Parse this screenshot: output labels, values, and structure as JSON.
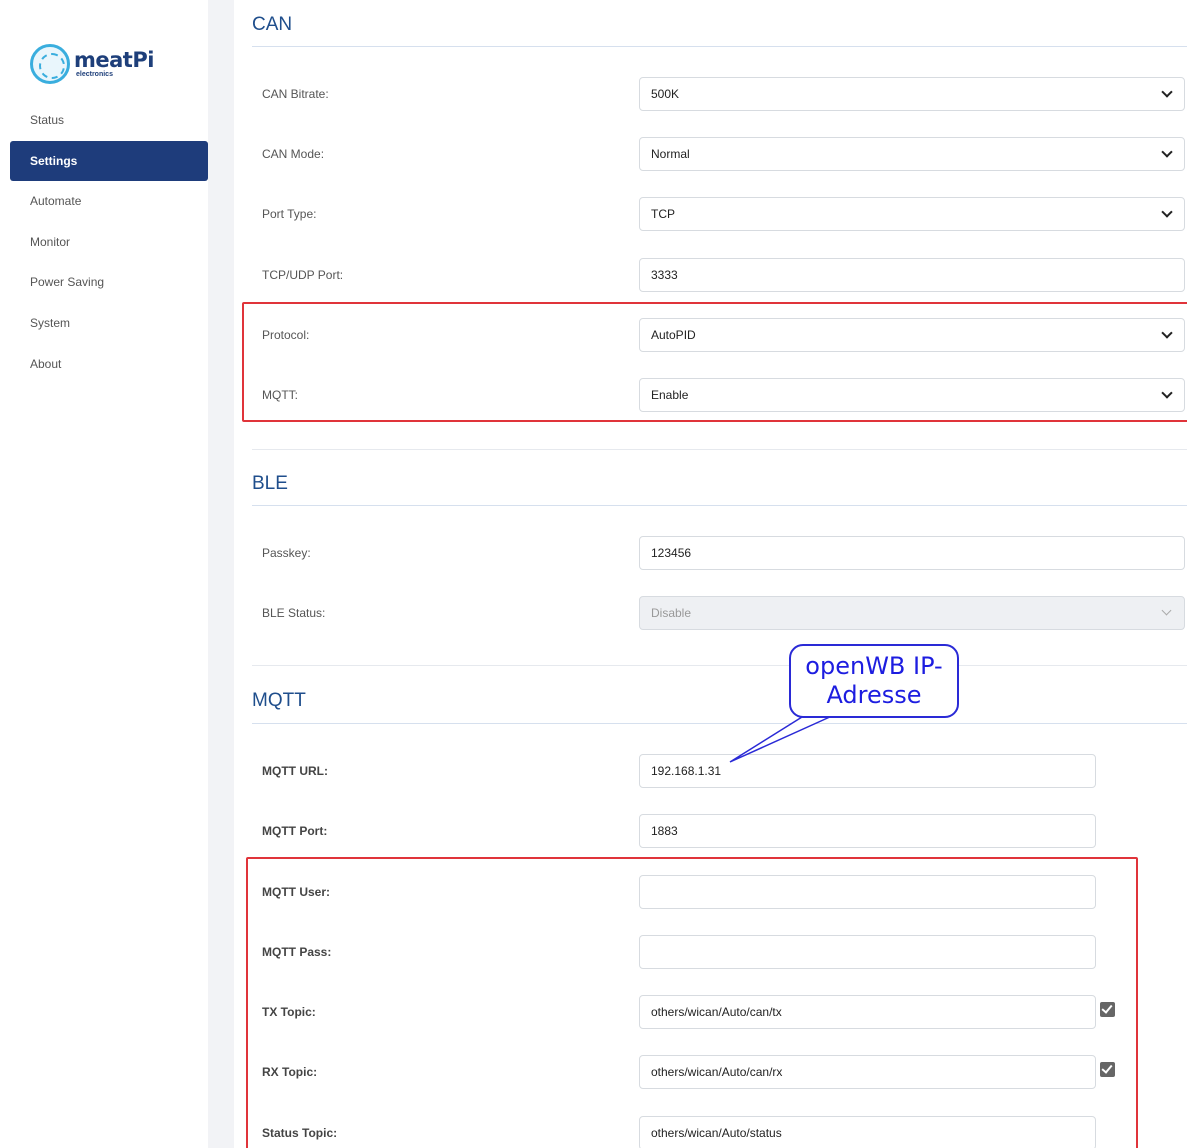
{
  "brand": {
    "name": "meatPi",
    "sub": "electronics"
  },
  "nav": [
    {
      "label": "Status",
      "active": false
    },
    {
      "label": "Settings",
      "active": true
    },
    {
      "label": "Automate",
      "active": false
    },
    {
      "label": "Monitor",
      "active": false
    },
    {
      "label": "Power Saving",
      "active": false
    },
    {
      "label": "System",
      "active": false
    },
    {
      "label": "About",
      "active": false
    }
  ],
  "can": {
    "title": "CAN",
    "bitrate": {
      "label": "CAN Bitrate:",
      "value": "500K"
    },
    "mode": {
      "label": "CAN Mode:",
      "value": "Normal"
    },
    "port_type": {
      "label": "Port Type:",
      "value": "TCP"
    },
    "port": {
      "label": "TCP/UDP Port:",
      "value": "3333"
    },
    "protocol": {
      "label": "Protocol:",
      "value": "AutoPID"
    },
    "mqtt": {
      "label": "MQTT:",
      "value": "Enable"
    }
  },
  "ble": {
    "title": "BLE",
    "passkey": {
      "label": "Passkey:",
      "value": "123456"
    },
    "status": {
      "label": "BLE Status:",
      "value": "Disable"
    }
  },
  "mqtt": {
    "title": "MQTT",
    "url": {
      "label": "MQTT URL:",
      "value": "192.168.1.31"
    },
    "port": {
      "label": "MQTT Port:",
      "value": "1883"
    },
    "user": {
      "label": "MQTT User:",
      "value": ""
    },
    "pass": {
      "label": "MQTT Pass:",
      "value": ""
    },
    "tx_topic": {
      "label": "TX Topic:",
      "value": "others/wican/Auto/can/tx",
      "checked": true
    },
    "rx_topic": {
      "label": "RX Topic:",
      "value": "others/wican/Auto/can/rx",
      "checked": true
    },
    "status_topic": {
      "label": "Status Topic:",
      "value": "others/wican/Auto/status"
    }
  },
  "annotation": {
    "line1": "openWB IP-",
    "line2": "Adresse",
    "color": "#1d1de0",
    "highlight_color": "#e0343a"
  },
  "colors": {
    "accent": "#1e3c7b",
    "section_title": "#1f4e8c"
  }
}
